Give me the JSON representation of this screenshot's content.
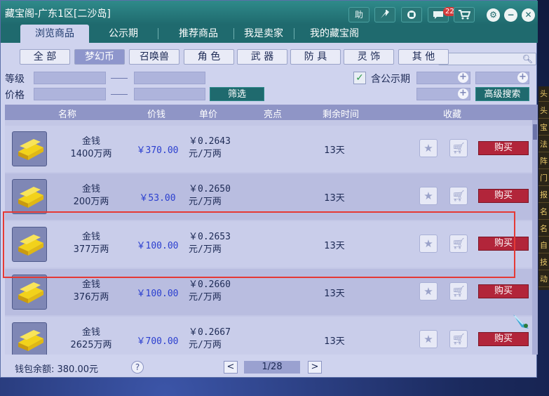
{
  "window": {
    "title": "藏宝阁-广东1区[二沙岛]",
    "help_label": "助",
    "message_count": "22"
  },
  "tabs": [
    {
      "label": "浏览商品"
    },
    {
      "label": "公示期"
    },
    {
      "label": "推荐商品"
    },
    {
      "label": "我是卖家"
    },
    {
      "label": "我的藏宝阁"
    }
  ],
  "categories": [
    {
      "label": "全 部"
    },
    {
      "label": "梦幻币"
    },
    {
      "label": "召唤兽"
    },
    {
      "label": "角 色"
    },
    {
      "label": "武 器"
    },
    {
      "label": "防 具"
    },
    {
      "label": "灵 饰"
    },
    {
      "label": "其 他"
    }
  ],
  "filters": {
    "level_label": "等级",
    "price_label": "价格",
    "filter_button": "筛选",
    "public_period_label": "含公示期",
    "advanced_search": "高级搜索",
    "public_period_checked": true
  },
  "table": {
    "headers": {
      "name": "名称",
      "price": "价钱",
      "unit_price": "单价",
      "highlight": "亮点",
      "remaining": "剩余时间",
      "favorite": "收藏"
    },
    "rows": [
      {
        "name": "金钱",
        "amount": "1400万两",
        "price": "￥370.00",
        "unit1": "￥0.2643",
        "unit2": "元/万两",
        "remaining": "13天",
        "buy": "购买"
      },
      {
        "name": "金钱",
        "amount": "200万两",
        "price": "￥53.00",
        "unit1": "￥0.2650",
        "unit2": "元/万两",
        "remaining": "13天",
        "buy": "购买"
      },
      {
        "name": "金钱",
        "amount": "377万两",
        "price": "￥100.00",
        "unit1": "￥0.2653",
        "unit2": "元/万两",
        "remaining": "13天",
        "buy": "购买"
      },
      {
        "name": "金钱",
        "amount": "376万两",
        "price": "￥100.00",
        "unit1": "￥0.2660",
        "unit2": "元/万两",
        "remaining": "13天",
        "buy": "购买"
      },
      {
        "name": "金钱",
        "amount": "2625万两",
        "price": "￥700.00",
        "unit1": "￥0.2667",
        "unit2": "元/万两",
        "remaining": "13天",
        "buy": "购买"
      }
    ]
  },
  "footer": {
    "wallet_label": "钱包余额: 380.00元",
    "help": "?",
    "prev": "<",
    "next": ">",
    "page": "1/28"
  },
  "side_panel": {
    "labels": [
      "头",
      "头",
      "宝",
      "法",
      "阵",
      "门",
      "报",
      "名",
      "名",
      "自",
      "技",
      "动"
    ]
  },
  "colors": {
    "title_bar": "#1f6a6e",
    "buy_button": "#b2253a",
    "price_text": "#2b3fcf",
    "highlight_box": "#e53935"
  }
}
